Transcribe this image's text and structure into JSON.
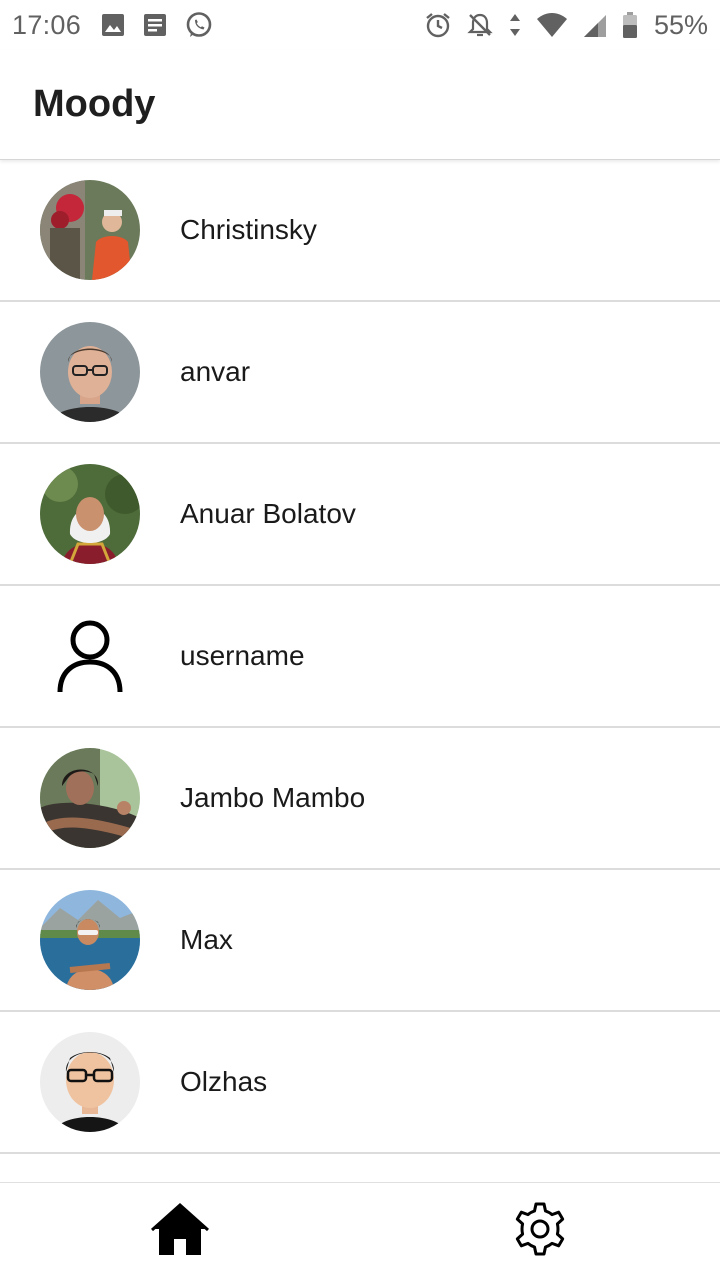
{
  "status_bar": {
    "time": "17:06",
    "battery": "55%",
    "left_icons": [
      "image-icon",
      "message-icon",
      "whatsapp-icon"
    ],
    "right_icons": [
      "alarm-icon",
      "notifications-off-icon",
      "data-arrows-icon",
      "wifi-icon",
      "signal-icon",
      "battery-icon"
    ]
  },
  "app_bar": {
    "title": "Moody"
  },
  "users": [
    {
      "name": "Christinsky",
      "avatar": "photo"
    },
    {
      "name": "anvar",
      "avatar": "photo"
    },
    {
      "name": "Anuar Bolatov",
      "avatar": "photo"
    },
    {
      "name": "username",
      "avatar": "person-outline-icon"
    },
    {
      "name": "Jambo Mambo",
      "avatar": "photo"
    },
    {
      "name": "Max",
      "avatar": "photo"
    },
    {
      "name": "Olzhas",
      "avatar": "photo"
    }
  ],
  "bottom_nav": {
    "items": [
      {
        "id": "home",
        "icon": "home-icon",
        "active": true
      },
      {
        "id": "settings",
        "icon": "gear-icon",
        "active": false
      }
    ]
  },
  "colors": {
    "text": "#1a1a1a",
    "divider": "#dcdcdc",
    "status_text": "#616161"
  }
}
